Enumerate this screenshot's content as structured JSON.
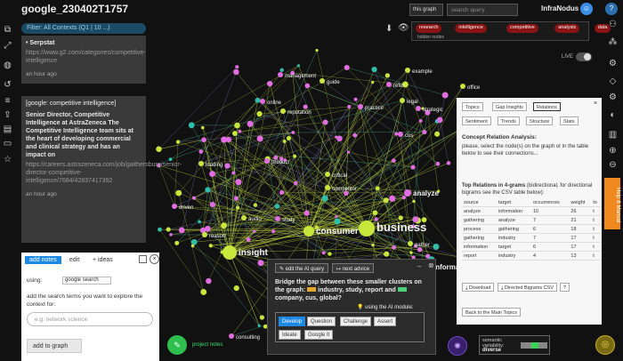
{
  "app": {
    "title": "google_230402T1757",
    "brand": "InfraNodus"
  },
  "filter": {
    "text": "Filter: All Contexts (Q1 | 10 ...)"
  },
  "header": {
    "graph_select": "this graph",
    "search_placeholder": "search query",
    "live_label": "LIVE",
    "hidden_nodes": "hidden nodes"
  },
  "tags": [
    "research",
    "intelligence",
    "competitive",
    "analysis",
    "data"
  ],
  "results": [
    {
      "header": "• Serpstat",
      "url": "https://www.g2.com/categories/competitive-intelligence",
      "time": "an hour ago"
    },
    {
      "header": "[google: competitive intelligence]",
      "body": "Senior Director, Competitive Intelligence at AstraZeneca The Competitive Intelligence team sits at the heart of developing commercial and clinical strategy and has an impact on",
      "url": "https://careers.astrazeneca.com/job/gaithersburg/senior-director-competitive-intelligence/7684/42837417392",
      "time": "an hour ago"
    }
  ],
  "notes": {
    "tab_add": "add notes",
    "tab_edit": "edit",
    "tab_ideas": "+ ideas",
    "using_label": "using:",
    "source": "google search",
    "description": "add the search terms you want to explore the context for:",
    "placeholder": "e.g. network science",
    "add_button": "add to graph",
    "project_notes": "project notes"
  },
  "panel": {
    "tabs": [
      "Topics",
      "Gap Insights",
      "Relations"
    ],
    "tabs2": [
      "Sentiment",
      "Trends",
      "Structure",
      "Stats"
    ],
    "heading": "Concept Relation Analysis:",
    "subheading": "please, select the node(s) on the graph or in the table below to see their connections...",
    "top_relations": "Top Relations in 4-grams",
    "top_relations_note": "(bidirectional, for directional bigrams see the CSV table below):",
    "columns": [
      "source",
      "target",
      "occurrences",
      "weight",
      "to"
    ],
    "rows": [
      [
        "analyze",
        "information",
        "10",
        "26",
        "t"
      ],
      [
        "gathering",
        "analyze",
        "7",
        "21",
        "t"
      ],
      [
        "process",
        "gathering",
        "6",
        "18",
        "t"
      ],
      [
        "gathering",
        "industry",
        "7",
        "17",
        "t"
      ],
      [
        "information",
        "target",
        "6",
        "17",
        "t"
      ],
      [
        "report",
        "industry",
        "4",
        "13",
        "t"
      ]
    ],
    "download": "Download",
    "csv": "Directed Bigrams CSV",
    "help": "?",
    "back": "Back to the Main Topics",
    "help_tab": "Help & Manual"
  },
  "advice": {
    "edit_query": "edit the AI query",
    "next_advice": "next advice",
    "text_a": "Bridge the gap between these smaller clusters on the graph: ",
    "cluster1": "industry, study, report",
    "text_and": " and ",
    "cluster2": "company, cus, global",
    "text_q": "?",
    "module_label": "using the AI module:",
    "modes": [
      "Develop",
      "Question",
      "Challenge",
      "Assert",
      "Ideate",
      "Google It"
    ]
  },
  "variability": {
    "label": "semantic variability:",
    "value": "diverse"
  },
  "nodes": [
    {
      "label": "business",
      "size": "big"
    },
    {
      "label": "insight",
      "size": "big"
    },
    {
      "label": "consumer",
      "size": "big"
    },
    {
      "label": "analyze",
      "size": "mid"
    },
    {
      "label": "gather",
      "size": "small"
    },
    {
      "label": "information",
      "size": "mid"
    },
    {
      "label": "competitor",
      "size": "small"
    },
    {
      "label": "management",
      "size": "small"
    },
    {
      "label": "guide",
      "size": "small"
    },
    {
      "label": "practice",
      "size": "small"
    },
    {
      "label": "legal",
      "size": "small"
    },
    {
      "label": "strategic",
      "size": "small"
    },
    {
      "label": "example",
      "size": "small"
    },
    {
      "label": "refer",
      "size": "small"
    },
    {
      "label": "office",
      "size": "small"
    },
    {
      "label": "online",
      "size": "small"
    },
    {
      "label": "reputation",
      "size": "small"
    },
    {
      "label": "cus",
      "size": "small"
    },
    {
      "label": "critical",
      "size": "small"
    },
    {
      "label": "product",
      "size": "small"
    },
    {
      "label": "leading",
      "size": "small"
    },
    {
      "label": "driven",
      "size": "small"
    },
    {
      "label": "audio",
      "size": "small"
    },
    {
      "label": "study",
      "size": "small"
    },
    {
      "label": "reason",
      "size": "small"
    },
    {
      "label": "consulting",
      "size": "small"
    }
  ],
  "colors": {
    "green": "#c8e63c",
    "pink": "#e06ee0",
    "teal": "#2fbfa8",
    "link": "#b5c93a"
  }
}
